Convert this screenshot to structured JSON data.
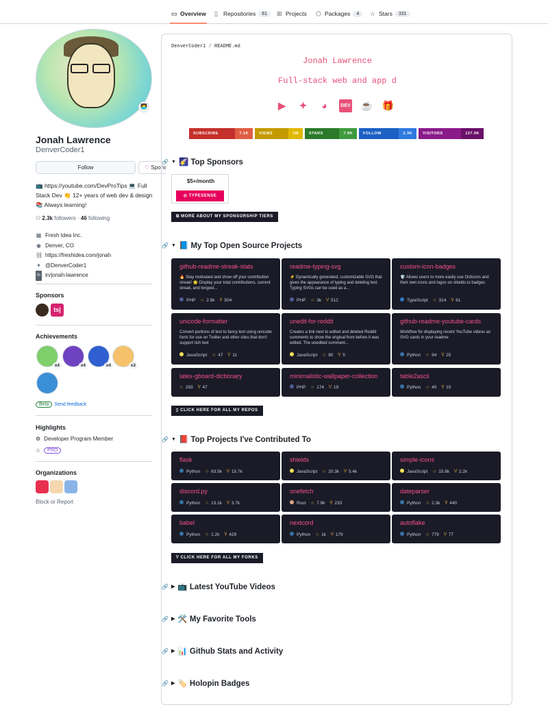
{
  "nav": {
    "tabs": [
      {
        "label": "Overview",
        "count": "",
        "icon": "book-icon"
      },
      {
        "label": "Repositories",
        "count": "61",
        "icon": "repo-icon"
      },
      {
        "label": "Projects",
        "count": "",
        "icon": "table-icon"
      },
      {
        "label": "Packages",
        "count": "4",
        "icon": "package-icon"
      },
      {
        "label": "Stars",
        "count": "331",
        "icon": "star-icon"
      }
    ]
  },
  "profile": {
    "name": "Jonah Lawrence",
    "login": "DenverCoder1",
    "status_emoji": "🧑‍💻",
    "follow_label": "Follow",
    "sponsor_label": "Sponsor",
    "bio": "📺 https://youtube.com/DevProTips 💻 Full Stack Dev 👏 12+ years of web dev & design 📚 Always learning!",
    "followers_count": "2.3k",
    "followers_label": "followers",
    "following_count": "46",
    "following_label": "following",
    "company": "Fresh Idea Inc.",
    "location": "Denver, CO",
    "website": "https://freshidea.com/jonah",
    "twitter": "@DenverCoder1",
    "linkedin": "in/jonah-lawrence"
  },
  "sidebar": {
    "sponsors_title": "Sponsors",
    "achievements_title": "Achievements",
    "achievements": [
      {
        "count": "x4",
        "color": "#7fcf6a"
      },
      {
        "count": "x4",
        "color": "#6f42c1"
      },
      {
        "count": "x4",
        "color": "#2f5fd0"
      },
      {
        "count": "x3",
        "color": "#f5c26b"
      },
      {
        "count": "",
        "color": "#3b8fd6"
      }
    ],
    "beta_label": "Beta",
    "feedback_label": "Send feedback",
    "highlights_title": "Highlights",
    "highlight_member": "Developer Program Member",
    "highlight_pro": "PRO",
    "organizations_title": "Organizations",
    "block_label": "Block or Report"
  },
  "readme": {
    "owner": "DenverCoder1",
    "file": "README.md",
    "title": "Jonah Lawrence",
    "subtitle": "Full-stack web and app d",
    "social_dev_label": "DEV",
    "badges": [
      {
        "label": "SUBSCRIBE",
        "value": "7.1K",
        "color_l": "#c4302b",
        "color_v": "#e05d44"
      },
      {
        "label": "VIEWS",
        "value": "1M",
        "color_l": "#c49a00",
        "color_v": "#e0b800"
      },
      {
        "label": "STARS",
        "value": "7.9K",
        "color_l": "#2a7a2a",
        "color_v": "#3e9a3e"
      },
      {
        "label": "FOLLOW",
        "value": "2.3K",
        "color_l": "#1c60c4",
        "color_v": "#2f79e0"
      },
      {
        "label": "VISITORS",
        "value": "137.9K",
        "color_l": "#8a1a8a",
        "color_v": "#6a0f6a"
      }
    ],
    "sections": {
      "sponsors": "🌠 Top Sponsors",
      "projects": "📘 My Top Open Source Projects",
      "contrib": "📕 Top Projects I've Contributed To",
      "youtube": "📺 Latest YouTube Videos",
      "tools": "🛠️ My Favorite Tools",
      "stats": "📊 Github Stats and Activity",
      "holopin": "🏷️ Holopin Badges"
    },
    "sponsor_tier": "$5+/month",
    "sponsor_name": "TYPESENSE",
    "sponsor_btn": "MORE ABOUT MY SPONSORSHIP TIERS",
    "repos_btn": "CLICK HERE FOR ALL MY REPOS",
    "forks_btn": "CLICK HERE FOR ALL MY FORKS",
    "projects": [
      {
        "name": "github-readme-streak-stats",
        "desc": "🔥 Stay motivated and show off your contribution streak! 🌟 Display your total contributions, current streak, and longest...",
        "lang": "PHP",
        "lang_color": "#4f5d95",
        "stars": "2.9k",
        "forks": "504"
      },
      {
        "name": "readme-typing-svg",
        "desc": "⚡ Dynamically generated, customizable SVG that gives the appearance of typing and deleting text. Typing SVGs can be used as a...",
        "lang": "PHP",
        "lang_color": "#4f5d95",
        "stars": "3k",
        "forks": "512"
      },
      {
        "name": "custom-icon-badges",
        "desc": "🛡️ Allows users to more easily use Octicons and their own icons and logos on shields.io badges",
        "lang": "TypeScript",
        "lang_color": "#3178c6",
        "stars": "314",
        "forks": "61"
      },
      {
        "name": "unicode-formatter",
        "desc": "Convert portions of text to fancy text using unicode fonts for use on Twitter and other sites that don't support rich text",
        "lang": "JavaScript",
        "lang_color": "#f1e05a",
        "stars": "47",
        "forks": "11"
      },
      {
        "name": "unedit-for-reddit",
        "desc": "Creates a link next to edited and deleted Reddit comments to show the original from before it was edited. The unedited comment...",
        "lang": "JavaScript",
        "lang_color": "#f1e05a",
        "stars": "80",
        "forks": "5"
      },
      {
        "name": "github-readme-youtube-cards",
        "desc": "Workflow for displaying recent YouTube videos as SVG cards in your readme",
        "lang": "Python",
        "lang_color": "#3572a5",
        "stars": "94",
        "forks": "25"
      },
      {
        "name": "latex-gboard-dictionary",
        "desc": "",
        "lang": "",
        "lang_color": "",
        "stars": "293",
        "forks": "47"
      },
      {
        "name": "minimalistic-wallpaper-collection",
        "desc": "",
        "lang": "PHP",
        "lang_color": "#4f5d95",
        "stars": "174",
        "forks": "19"
      },
      {
        "name": "table2ascii",
        "desc": "",
        "lang": "Python",
        "lang_color": "#3572a5",
        "stars": "45",
        "forks": "10"
      }
    ],
    "contrib": [
      {
        "name": "flask",
        "lang": "Python",
        "lang_color": "#3572a5",
        "stars": "63.5k",
        "forks": "15.7k"
      },
      {
        "name": "shields",
        "lang": "JavaScript",
        "lang_color": "#f1e05a",
        "stars": "20.3k",
        "forks": "5.4k"
      },
      {
        "name": "simple-icons",
        "lang": "JavaScript",
        "lang_color": "#f1e05a",
        "stars": "15.8k",
        "forks": "2.2k"
      },
      {
        "name": "discord.py",
        "lang": "Python",
        "lang_color": "#3572a5",
        "stars": "13.1k",
        "forks": "3.7k"
      },
      {
        "name": "onefetch",
        "lang": "Rust",
        "lang_color": "#dea584",
        "stars": "7.9k",
        "forks": "233"
      },
      {
        "name": "dateparser",
        "lang": "Python",
        "lang_color": "#3572a5",
        "stars": "2.3k",
        "forks": "440"
      },
      {
        "name": "babel",
        "lang": "Python",
        "lang_color": "#3572a5",
        "stars": "1.2k",
        "forks": "429"
      },
      {
        "name": "nextcord",
        "lang": "Python",
        "lang_color": "#3572a5",
        "stars": "1k",
        "forks": "179"
      },
      {
        "name": "autoflake",
        "lang": "Python",
        "lang_color": "#3572a5",
        "stars": "779",
        "forks": "77"
      }
    ]
  }
}
